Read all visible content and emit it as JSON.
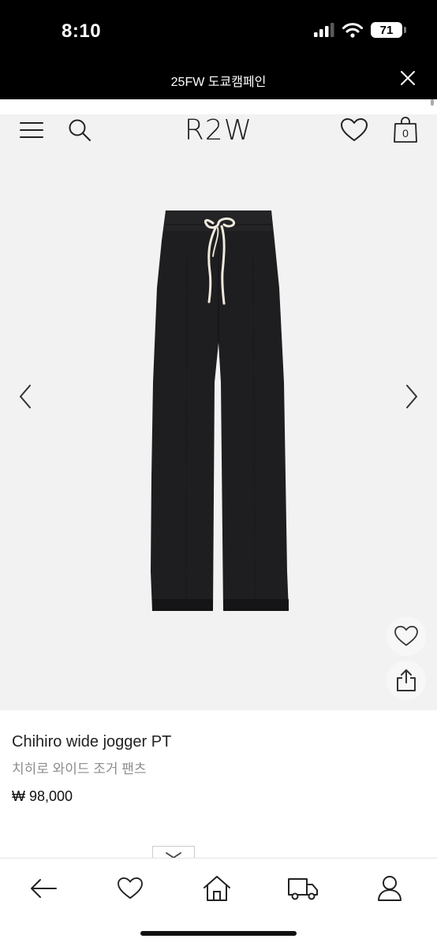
{
  "status_bar": {
    "time": "8:10",
    "battery": "71"
  },
  "banner": {
    "text": "25FW 도쿄캠페인"
  },
  "header": {
    "logo": "R2W",
    "cart_count": "0"
  },
  "product": {
    "name": "Chihiro wide jogger PT",
    "name_ko": "치히로 와이드 조거 팬츠",
    "price": "₩ 98,000"
  },
  "icons": {
    "menu": "menu-icon",
    "search": "search-icon",
    "wishlist": "heart-icon",
    "cart": "bag-icon",
    "prev": "chevron-left-icon",
    "next": "chevron-right-icon",
    "share": "share-icon",
    "nav_back": "arrow-left-icon",
    "nav_like": "heart-icon",
    "nav_home": "home-icon",
    "nav_delivery": "truck-icon",
    "nav_account": "user-icon"
  },
  "colors": {
    "background": "#f2f2f2",
    "banner": "#000000",
    "product": "#1e1e20",
    "drawstring": "#efe9dc"
  }
}
